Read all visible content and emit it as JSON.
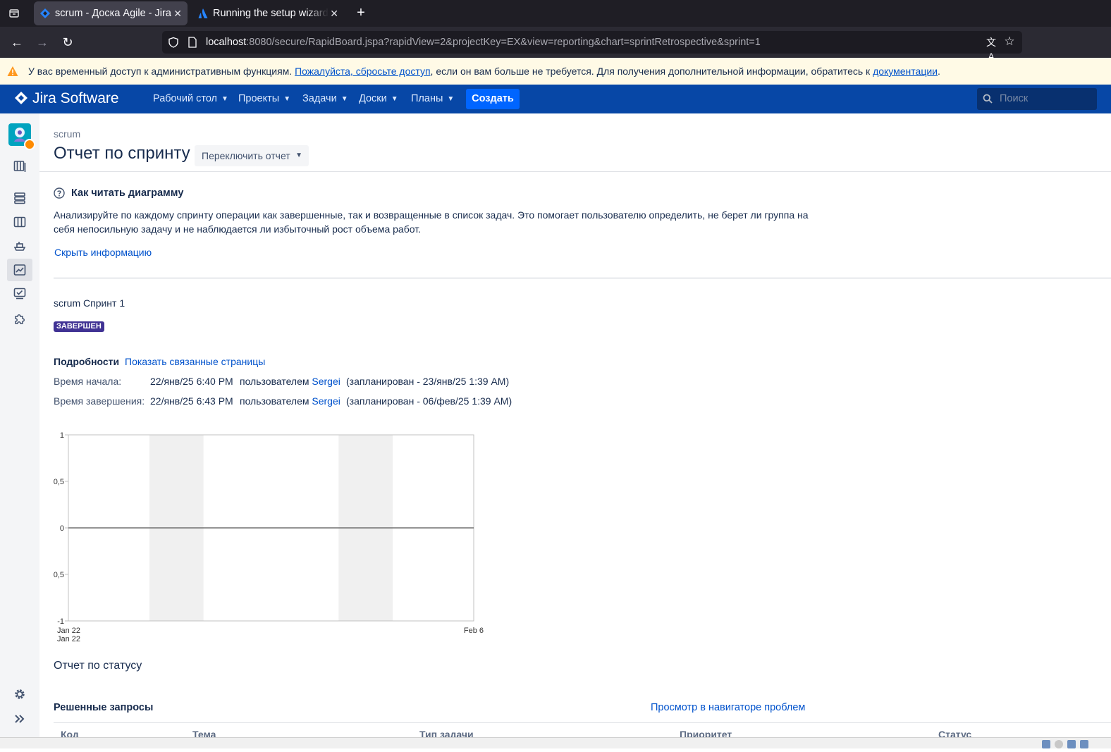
{
  "browser": {
    "tabs": [
      {
        "title": "scrum - Доска Agile - Jira",
        "active": true,
        "icon": "jira-diamond-icon"
      },
      {
        "title": "Running the setup wizard",
        "active": false,
        "icon": "atlassian-icon"
      }
    ],
    "url_host": "localhost",
    "url_rest": ":8080/secure/RapidBoard.jspa?rapidView=2&projectKey=EX&view=reporting&chart=sprintRetrospective&sprint=1"
  },
  "warning": {
    "text_before": "У вас временный доступ к административным функциям.",
    "link1": "Пожалуйста, сбросьте доступ",
    "text_middle": ", если он вам больше не требуется. Для получения дополнительной информации, обратитесь к",
    "link2": "документации",
    "text_after": "."
  },
  "header": {
    "logo": "Jira Software",
    "menus": [
      "Рабочий стол",
      "Проекты",
      "Задачи",
      "Доски",
      "Планы"
    ],
    "create": "Создать",
    "search_placeholder": "Поиск"
  },
  "page": {
    "breadcrumb": "scrum",
    "title": "Отчет по спринту",
    "switch_report": "Переключить отчет",
    "help_title": "Как читать диаграмму",
    "help_text": "Анализируйте по каждому спринту операции как завершенные, так и возвращенные в список задач. Это помогает пользователю определить, не берет ли группа на себя непосильную задачу и не наблюдается ли избыточный рост объема работ.",
    "hide_info": "Скрыть информацию",
    "sprint_name": "scrum Спринт 1",
    "status_lozenge": "ЗАВЕРШЕН",
    "details_label": "Подробности",
    "related_pages": "Показать связанные страницы",
    "start": {
      "label": "Время начала:",
      "value": "22/янв/25 6:40 PM",
      "by": "пользователем",
      "user": "Sergei",
      "planned": "(запланирован - 23/янв/25 1:39 AM)"
    },
    "end": {
      "label": "Время завершения:",
      "value": "22/янв/25 6:43 PM",
      "by": "пользователем",
      "user": "Sergei",
      "planned": "(запланирован - 06/фев/25 1:39 AM)"
    },
    "status_report": "Отчет по статусу",
    "resolved_issues": "Решенные запросы",
    "view_in_navigator": "Просмотр в навигаторе проблем",
    "table_headers": [
      "Код",
      "Тема",
      "Тип задачи",
      "Приоритет",
      "Статус"
    ]
  },
  "chart_data": {
    "type": "line",
    "x_tick_labels": [
      "Jan 22\nJan 22",
      "Feb 6"
    ],
    "y_tick_labels": [
      "1",
      "0,5",
      "0",
      "0,5",
      "-1"
    ],
    "ylim": [
      -1,
      1
    ],
    "xlim": [
      "2025-01-22",
      "2025-02-06"
    ],
    "nonworking_bands": [
      [
        "2025-01-25",
        "2025-01-27"
      ],
      [
        "2025-02-01",
        "2025-02-03"
      ]
    ],
    "series": [
      {
        "values": [
          [
            "2025-01-22",
            0
          ],
          [
            "2025-02-06",
            0
          ]
        ],
        "color": "#707070"
      }
    ],
    "grid": false
  }
}
